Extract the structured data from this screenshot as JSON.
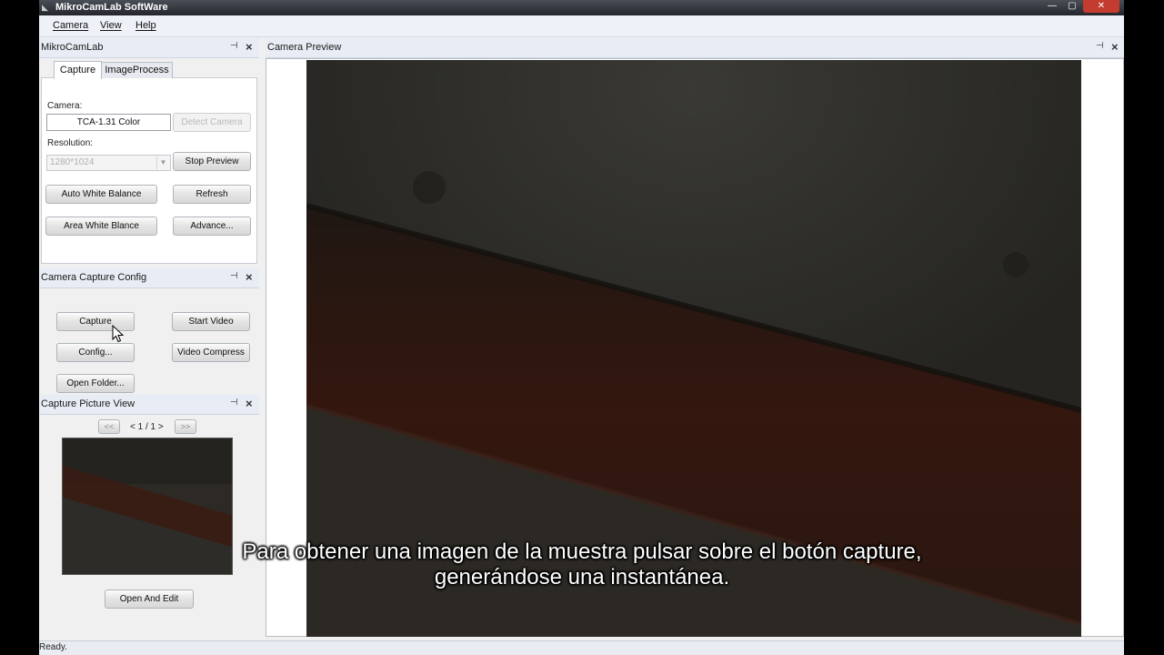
{
  "window": {
    "title": "MikroCamLab SoftWare",
    "min": "—",
    "max": "▢",
    "close": "✕"
  },
  "menu": [
    "Camera",
    "View",
    "Help"
  ],
  "left_panel": {
    "title": "MikroCamLab",
    "tabs": [
      "Capture",
      "ImageProcess"
    ],
    "camera_label": "Camera:",
    "camera_value": "TCA-1.31 Color",
    "detect_camera": "Detect Camera",
    "resolution_label": "Resolution:",
    "resolution_value": "1280*1024",
    "stop_preview": "Stop Preview",
    "auto_white_balance": "Auto White Balance",
    "refresh": "Refresh",
    "area_white_balance": "Area White Blance",
    "advance": "Advance..."
  },
  "capture_config": {
    "title": "Camera Capture Config",
    "capture": "Capture",
    "start_video": "Start Video",
    "config": "Config...",
    "video_compress": "Video Compress",
    "open_folder": "Open Folder..."
  },
  "picture_view": {
    "title": "Capture Picture View",
    "prev": "<<",
    "page": "< 1 / 1 >",
    "next": ">>",
    "open_and_edit": "Open And Edit"
  },
  "preview": {
    "title": "Camera Preview"
  },
  "status": {
    "text": "Ready."
  },
  "subtitles": [
    "Para obtener una imagen de la muestra pulsar sobre el botón capture,",
    "generándose una instantánea."
  ],
  "icons": {
    "pin": "pin-icon",
    "close": "close-icon",
    "dropdown": "chevron-down-icon",
    "cursor": "mouse-cursor-icon"
  }
}
